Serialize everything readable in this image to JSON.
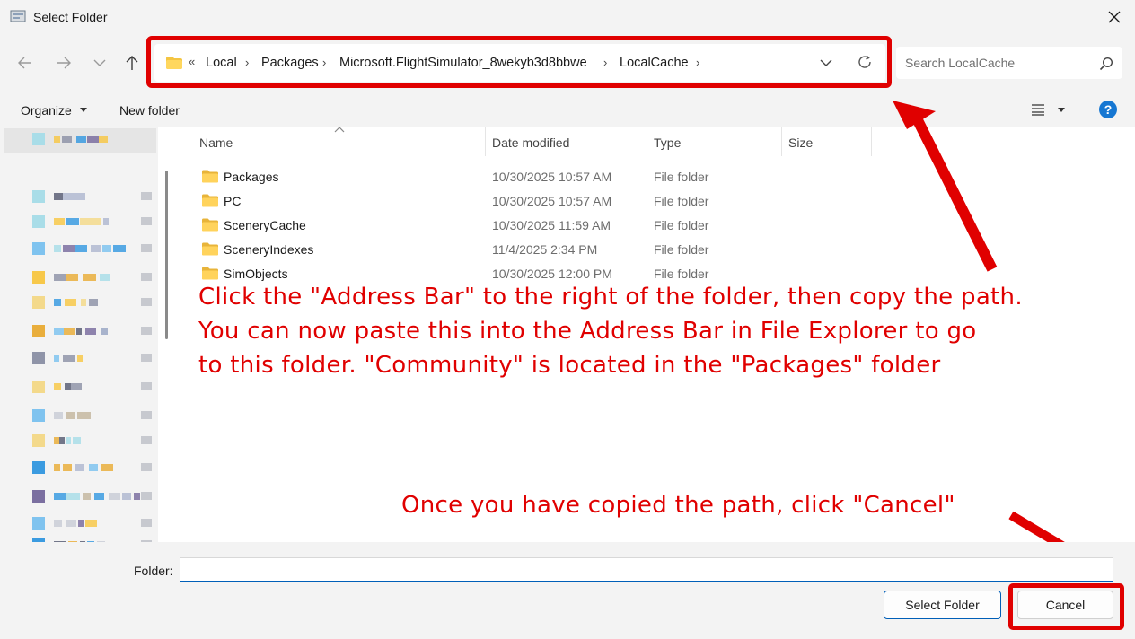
{
  "window": {
    "title": "Select Folder"
  },
  "breadcrumb": {
    "overflow": "«",
    "items": [
      "Local",
      "Packages",
      "Microsoft.FlightSimulator_8wekyb3d8bbwe",
      "LocalCache"
    ],
    "separator": "›"
  },
  "search": {
    "placeholder": "Search LocalCache"
  },
  "toolbar": {
    "organize_label": "Organize",
    "new_folder_label": "New folder"
  },
  "columns": [
    "Name",
    "Date modified",
    "Type",
    "Size"
  ],
  "files": [
    {
      "name": "Packages",
      "date": "10/30/2025 10:57 AM",
      "type": "File folder"
    },
    {
      "name": "PC",
      "date": "10/30/2025 10:57 AM",
      "type": "File folder"
    },
    {
      "name": "SceneryCache",
      "date": "10/30/2025 11:59 AM",
      "type": "File folder"
    },
    {
      "name": "SceneryIndexes",
      "date": "11/4/2025 2:34 PM",
      "type": "File folder"
    },
    {
      "name": "SimObjects",
      "date": "10/30/2025 12:00 PM",
      "type": "File folder"
    }
  ],
  "annotations": {
    "main_lines": [
      "Click the \"Address Bar\" to the right of the folder, then copy the path.",
      "You can now paste this into the Address Bar in File Explorer to go",
      "to this folder. \"Community\" is located in the \"Packages\" folder"
    ],
    "cancel_note": "Once you have copied the path, click \"Cancel\""
  },
  "footer": {
    "folder_label": "Folder:",
    "folder_value": "",
    "select_button": "Select Folder",
    "cancel_button": "Cancel"
  },
  "colors": {
    "annotation_red": "#e00000",
    "accent_blue": "#005fb8",
    "folder_yellow": "#f4c542"
  }
}
